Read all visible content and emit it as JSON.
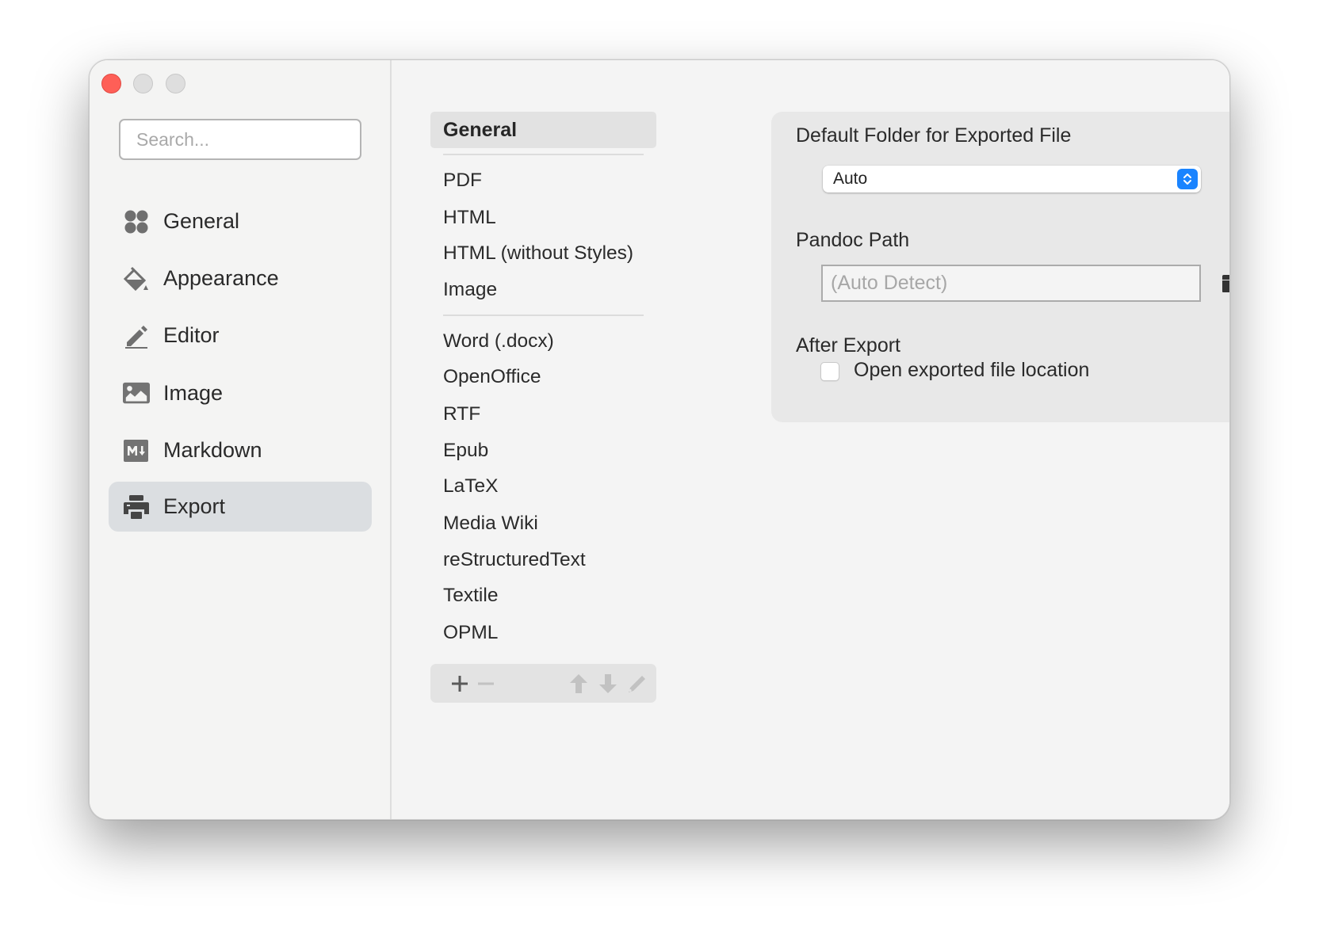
{
  "window": {
    "controls": [
      "close",
      "minimize",
      "maximize"
    ]
  },
  "sidebar": {
    "search_placeholder": "Search...",
    "items": [
      {
        "label": "General",
        "icon": "grid-circles-icon",
        "active": false
      },
      {
        "label": "Appearance",
        "icon": "paint-bucket-icon",
        "active": false
      },
      {
        "label": "Editor",
        "icon": "pencil-icon",
        "active": false
      },
      {
        "label": "Image",
        "icon": "image-icon",
        "active": false
      },
      {
        "label": "Markdown",
        "icon": "markdown-icon",
        "active": false
      },
      {
        "label": "Export",
        "icon": "printer-icon",
        "active": true
      }
    ]
  },
  "formats": {
    "selected": "General",
    "group1": [
      "PDF",
      "HTML",
      "HTML (without Styles)",
      "Image"
    ],
    "group2": [
      "Word (.docx)",
      "OpenOffice",
      "RTF",
      "Epub",
      "LaTeX",
      "Media Wiki",
      "reStructuredText",
      "Textile",
      "OPML"
    ],
    "toolbar": {
      "add": "+",
      "remove": "−",
      "move_up": "move-up",
      "move_down": "move-down",
      "edit": "edit"
    }
  },
  "settings": {
    "default_folder_label": "Default Folder for Exported File",
    "default_folder_value": "Auto",
    "pandoc_label": "Pandoc Path",
    "pandoc_placeholder": "(Auto Detect)",
    "after_export_label": "After Export",
    "open_location_label": "Open exported file location",
    "open_location_checked": false
  },
  "colors": {
    "accent": "#1a84ff",
    "close": "#fe5f57",
    "active_sidebar": "#dbdee1"
  }
}
